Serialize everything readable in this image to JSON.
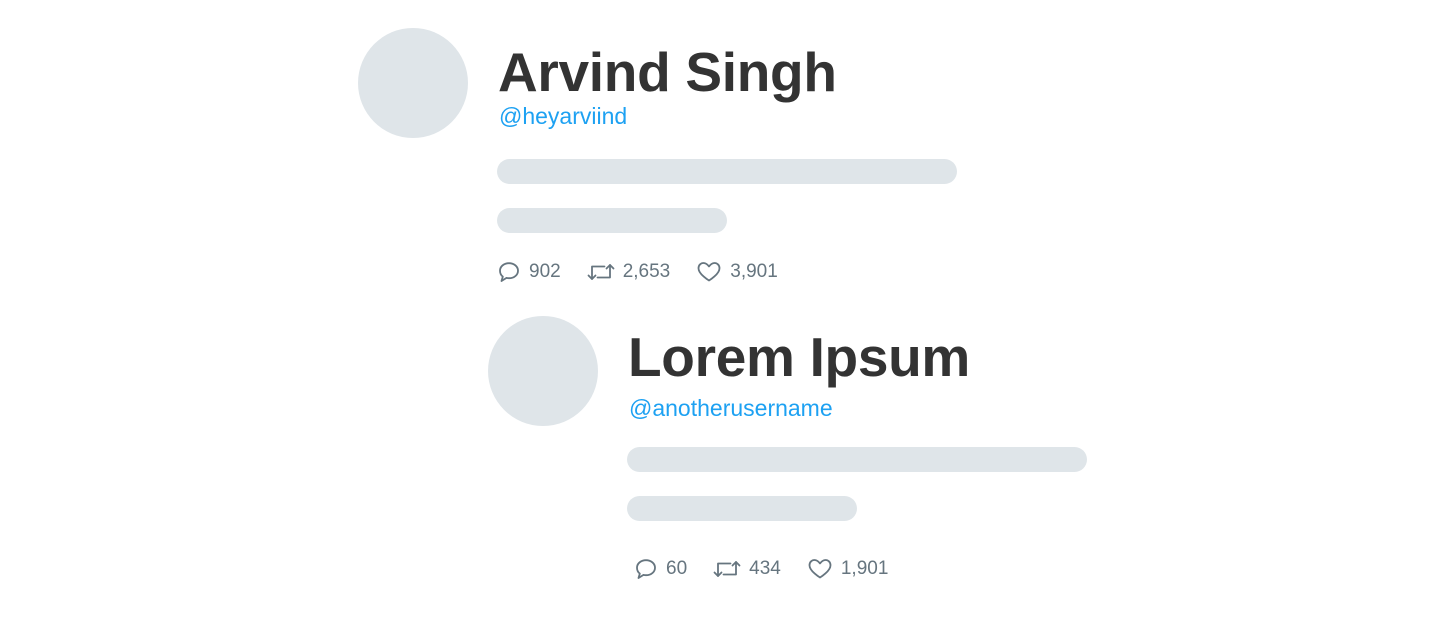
{
  "tweets": [
    {
      "name": "Arvind Singh",
      "handle": "@heyarviind",
      "replies": "902",
      "retweets": "2,653",
      "likes": "3,901"
    },
    {
      "name": "Lorem Ipsum",
      "handle": "@anotherusername",
      "replies": "60",
      "retweets": "434",
      "likes": "1,901"
    }
  ],
  "colors": {
    "placeholder": "#dfe5e9",
    "handle": "#1da1f2",
    "name": "#333333",
    "meta": "#66757f"
  },
  "icons": [
    "reply-icon",
    "retweet-icon",
    "like-icon"
  ]
}
